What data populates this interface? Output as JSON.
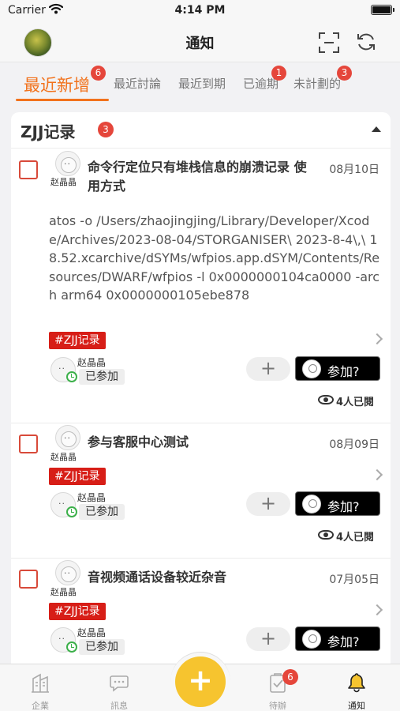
{
  "status_bar": {
    "carrier": "Carrier",
    "time": "4:14 PM"
  },
  "nav": {
    "title": "通知"
  },
  "tabs": [
    {
      "label": "最近新增",
      "badge": "6",
      "active": true
    },
    {
      "label": "最近討論",
      "badge": ""
    },
    {
      "label": "最近到期",
      "badge": ""
    },
    {
      "label": "已逾期",
      "badge": "1"
    },
    {
      "label": "未計劃的",
      "badge": "3"
    }
  ],
  "group": {
    "title": "ZJJ记录",
    "badge": "3"
  },
  "items": [
    {
      "author": "赵晶晶",
      "title": "命令行定位只有堆栈信息的崩溃记录  使用方式",
      "date": "08月10日",
      "body": "atos -o /Users/zhaojingjing/Library/Developer/Xcode/Archives/2023-08-04/STORGANISER\\ 2023-8-4\\,\\ 18.52.xcarchive/dSYMs/wfpios.app.dSYM/Contents/Resources/DWARF/wfpios -l 0x0000000104ca0000 -arch arm64 0x0000000105ebe878",
      "tag": "#ZJJ记录",
      "participant": "赵晶晶",
      "joined_label": "已参加",
      "plus": "+",
      "join_label": "参加?",
      "read_count": "4人已閱"
    },
    {
      "author": "赵晶晶",
      "title": "参与客服中心测试",
      "date": "08月09日",
      "tag": "#ZJJ记录",
      "participant": "赵晶晶",
      "joined_label": "已参加",
      "plus": "+",
      "join_label": "参加?",
      "read_count": "4人已閱"
    },
    {
      "author": "赵晶晶",
      "title": "音视频通话设备较近杂音",
      "date": "07月05日",
      "tag": "#ZJJ记录",
      "participant": "赵晶晶",
      "joined_label": "已参加",
      "plus": "+",
      "join_label": "参加?"
    }
  ],
  "tabbar": {
    "items": [
      {
        "label": "企業",
        "icon": "building-icon"
      },
      {
        "label": "訊息",
        "icon": "chat-bubble-icon"
      },
      {
        "label": "待辦",
        "icon": "clipboard-check-icon",
        "badge": "6"
      },
      {
        "label": "通知",
        "icon": "bell-icon",
        "active": true
      }
    ],
    "fab": "+"
  },
  "colors": {
    "accent": "#f2721c",
    "badge": "#e5463b",
    "tag": "#d71e17",
    "fab": "#f6c42f"
  }
}
